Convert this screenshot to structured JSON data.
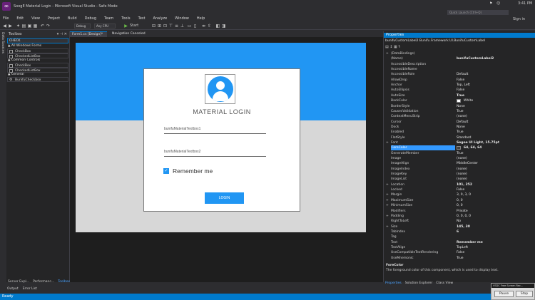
{
  "window": {
    "title": "SoogE Material Login - Microsoft Visual Studio - Safe Mode",
    "time": "3:41 PM",
    "quick_launch_placeholder": "Quick Launch (Ctrl+Q)",
    "sign_in": "Sign in",
    "win_controls": [
      "—",
      "☐",
      "✕"
    ]
  },
  "menu": [
    "File",
    "Edit",
    "View",
    "Project",
    "Build",
    "Debug",
    "Team",
    "Tools",
    "Test",
    "Analyze",
    "Window",
    "Help"
  ],
  "toolbar": {
    "config": "Debug",
    "platform": "Any CPU",
    "start": "Start"
  },
  "left_strip": "Data Sources",
  "toolbox": {
    "title": "Toolbox",
    "search": "CHECK",
    "groups": [
      {
        "label": "▲ All Windows Forms",
        "items": [
          "CheckBox",
          "CheckedListBox"
        ]
      },
      {
        "label": "▲ Common Controls",
        "items": [
          "CheckBox",
          "CheckedListBox"
        ]
      },
      {
        "label": "▲ General",
        "items": [
          "BunifuCheckbox"
        ]
      }
    ]
  },
  "doc_tabs": {
    "active": "Form1.cs [Design]*",
    "inactive": "Navigation Canceled"
  },
  "form": {
    "card_title": "MATERIAL LOGIN",
    "field1_placeholder": "bunifuMaterialTextbox1",
    "field2_placeholder": "bunifuMaterialTextbox2",
    "remember_label": "Remember me",
    "remember_checked": true,
    "login_button": "LOGIN",
    "colors": {
      "blue": "#2196f3",
      "grey": "#d7d7d7",
      "card": "#ffffff"
    }
  },
  "properties": {
    "title": "Properties",
    "object": "bunifuCustomLabel2  Bunifu.Framework.UI.BunifuCustomLabel",
    "rows": [
      {
        "key": "(DataBindings)",
        "value": "",
        "expand": "+"
      },
      {
        "key": "(Name)",
        "value": "bunifuCustomLabel2",
        "bold": true
      },
      {
        "key": "AccessibleDescription",
        "value": ""
      },
      {
        "key": "AccessibleName",
        "value": ""
      },
      {
        "key": "AccessibleRole",
        "value": "Default"
      },
      {
        "key": "AllowDrop",
        "value": "False"
      },
      {
        "key": "Anchor",
        "value": "Top, Left"
      },
      {
        "key": "AutoEllipsis",
        "value": "False"
      },
      {
        "key": "AutoSize",
        "value": "True",
        "bold": true
      },
      {
        "key": "BackColor",
        "value": "White",
        "swatch": "#ffffff"
      },
      {
        "key": "BorderStyle",
        "value": "None"
      },
      {
        "key": "CausesValidation",
        "value": "True"
      },
      {
        "key": "ContextMenuStrip",
        "value": "(none)"
      },
      {
        "key": "Cursor",
        "value": "Default"
      },
      {
        "key": "Dock",
        "value": "None"
      },
      {
        "key": "Enabled",
        "value": "True"
      },
      {
        "key": "FlatStyle",
        "value": "Standard"
      },
      {
        "key": "Font",
        "value": "Segoe UI Light, 15.75pt",
        "bold": true,
        "expand": "+"
      },
      {
        "key": "ForeColor",
        "value": "64, 64, 64",
        "bold": true,
        "selected": true,
        "swatch": "#404040"
      },
      {
        "key": "GenerateMember",
        "value": "True"
      },
      {
        "key": "Image",
        "value": "(none)"
      },
      {
        "key": "ImageAlign",
        "value": "MiddleCenter"
      },
      {
        "key": "ImageIndex",
        "value": "(none)"
      },
      {
        "key": "ImageKey",
        "value": "(none)"
      },
      {
        "key": "ImageList",
        "value": "(none)"
      },
      {
        "key": "Location",
        "value": "101, 252",
        "bold": true,
        "expand": "+"
      },
      {
        "key": "Locked",
        "value": "False"
      },
      {
        "key": "Margin",
        "value": "3, 0, 3, 0",
        "expand": "+"
      },
      {
        "key": "MaximumSize",
        "value": "0, 0",
        "expand": "+"
      },
      {
        "key": "MinimumSize",
        "value": "0, 0",
        "expand": "+"
      },
      {
        "key": "Modifiers",
        "value": "Private"
      },
      {
        "key": "Padding",
        "value": "0, 0, 0, 0",
        "expand": "+"
      },
      {
        "key": "RightToLeft",
        "value": "No"
      },
      {
        "key": "Size",
        "value": "145, 30",
        "bold": true,
        "expand": "+"
      },
      {
        "key": "TabIndex",
        "value": "6",
        "bold": true
      },
      {
        "key": "Tag",
        "value": ""
      },
      {
        "key": "Text",
        "value": "Remember me",
        "bold": true
      },
      {
        "key": "TextAlign",
        "value": "TopLeft"
      },
      {
        "key": "UseCompatibleTextRendering",
        "value": "False"
      },
      {
        "key": "UseMnemonic",
        "value": "True"
      }
    ],
    "desc_title": "ForeColor",
    "desc_text": "The foreground color of this component, which is used to display text.",
    "tabs": [
      "Properties",
      "Solution Explorer",
      "Class View"
    ]
  },
  "bottom_tabs": [
    "Server Expl...",
    "Performanc...",
    "Toolbox"
  ],
  "output_tabs": [
    "Output",
    "Error List"
  ],
  "status": "Ready",
  "recorder": {
    "title": "VSDC Free Screen Rec...",
    "pause": "Pause",
    "stop": "Stop"
  }
}
